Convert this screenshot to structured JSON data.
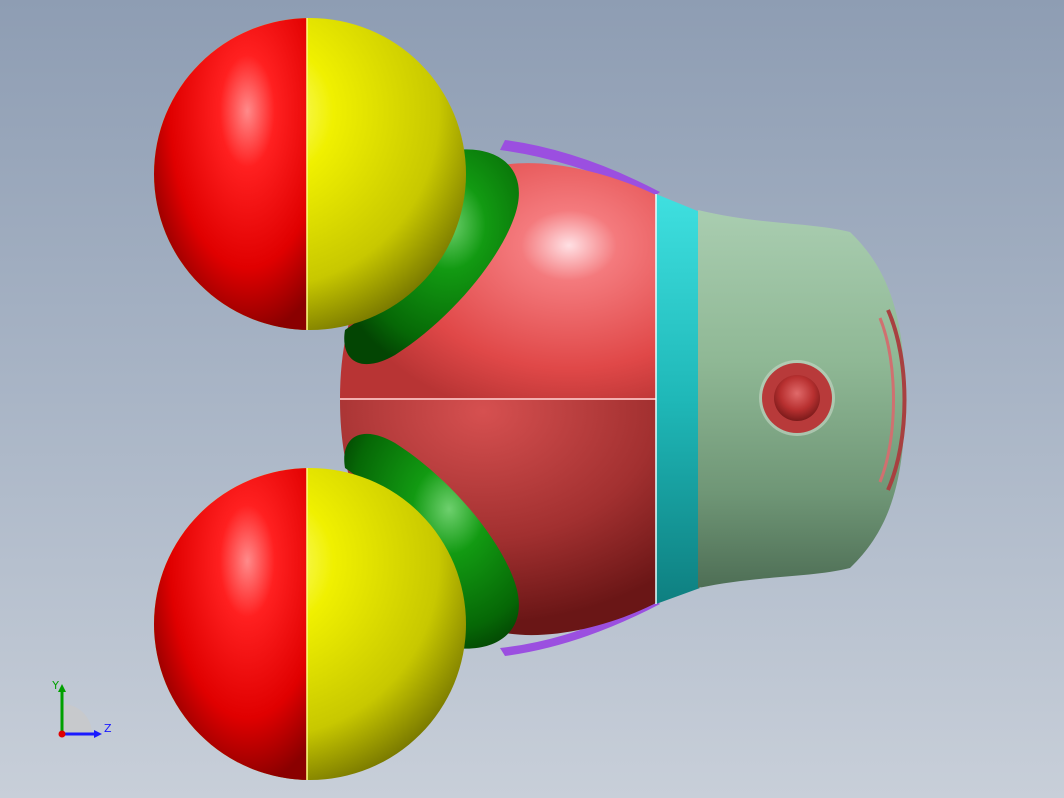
{
  "viewport": {
    "background_top": "#8e9db3",
    "background_bottom": "#c8cfd9"
  },
  "model": {
    "colors": {
      "sphere_red": "#ff0000",
      "sphere_yellow": "#ffff00",
      "neck_green": "#0a8a0a",
      "body_red": "#e04a4a",
      "band_cyan": "#20c8c8",
      "cap_green": "#8fb89a",
      "button_red": "#c03a3a",
      "edge_purple": "#9b4fe0"
    }
  },
  "triad": {
    "y_label": "Y",
    "z_label": "Z",
    "y_color": "#00a000",
    "z_color": "#1a1aff",
    "x_color": "#e00000"
  }
}
